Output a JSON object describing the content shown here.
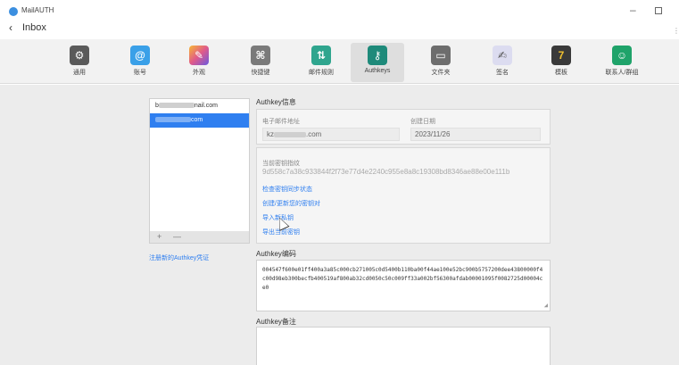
{
  "app": {
    "title": "MailAUTH",
    "back_label": "Inbox",
    "more": "⋮",
    "min": "–"
  },
  "toolbar": [
    {
      "name": "tab-general",
      "label": "通用",
      "icon": "gear-icon",
      "glyph": "⚙",
      "color": "#5a5a5a"
    },
    {
      "name": "tab-accounts",
      "label": "账号",
      "icon": "at-icon",
      "glyph": "@",
      "color": "#3aa0e8"
    },
    {
      "name": "tab-appearance",
      "label": "外观",
      "icon": "paintbrush-icon",
      "glyph": "✎",
      "color": "#e05a8a"
    },
    {
      "name": "tab-shortcuts",
      "label": "快捷键",
      "icon": "command-icon",
      "glyph": "⌘",
      "color": "#7a7a7a"
    },
    {
      "name": "tab-mail-rules",
      "label": "邮件规则",
      "icon": "rules-icon",
      "glyph": "⇅",
      "color": "#2fa58e"
    },
    {
      "name": "tab-authkeys",
      "label": "Authkeys",
      "icon": "key-icon",
      "glyph": "⚷",
      "color": "#1e8a7a"
    },
    {
      "name": "tab-folders",
      "label": "文件夹",
      "icon": "folder-icon",
      "glyph": "▭",
      "color": "#6d6d6d"
    },
    {
      "name": "tab-signature",
      "label": "签名",
      "icon": "signature-icon",
      "glyph": "✍",
      "color": "#c9c9e8"
    },
    {
      "name": "tab-templates",
      "label": "模板",
      "icon": "template-icon",
      "glyph": "7",
      "color": "#d8a21a"
    },
    {
      "name": "tab-contacts",
      "label": "联系人/群组",
      "icon": "contacts-icon",
      "glyph": "👤",
      "color": "#1fa36a"
    }
  ],
  "accounts": {
    "items": [
      {
        "prefix": "b",
        "suffix": "nail.com"
      },
      {
        "prefix": "",
        "suffix": "com"
      }
    ],
    "add": "+",
    "remove": "—",
    "register_link": "注册新的Authkey凭证"
  },
  "authkey_info": {
    "title": "Authkey信息",
    "email_label": "电子邮件地址",
    "email_prefix": "kz",
    "email_suffix": ".com",
    "date_label": "创建日期",
    "date_value": "2023/11/26",
    "fingerprint_label": "当前密钥指纹",
    "fingerprint_value": "9d558c7a38c933844f2f73e77d4e2240c955e8a8c19308bd8346ae88e00e111b",
    "links": [
      "检查密钥同步状态",
      "创建/更新您的密钥对",
      "导入新私钥",
      "导出当前密钥"
    ]
  },
  "authkey_code": {
    "title": "Authkey编码",
    "value": "004547f600e01ff400a3a85c000cb271005c0d5400b110ba00f44ae100e52bc900b5757200dee43800000f4c00d98eb300becfb400519af800ab32cd0050c50c009ff33a002bf56300afdab00001095f0082725d00004ce0"
  },
  "authkey_note": {
    "title": "Authkey备注"
  },
  "colors": {
    "accent": "#2f7ff0",
    "toolbar_bg": "#f2f2f2",
    "content_bg": "#ececec"
  }
}
